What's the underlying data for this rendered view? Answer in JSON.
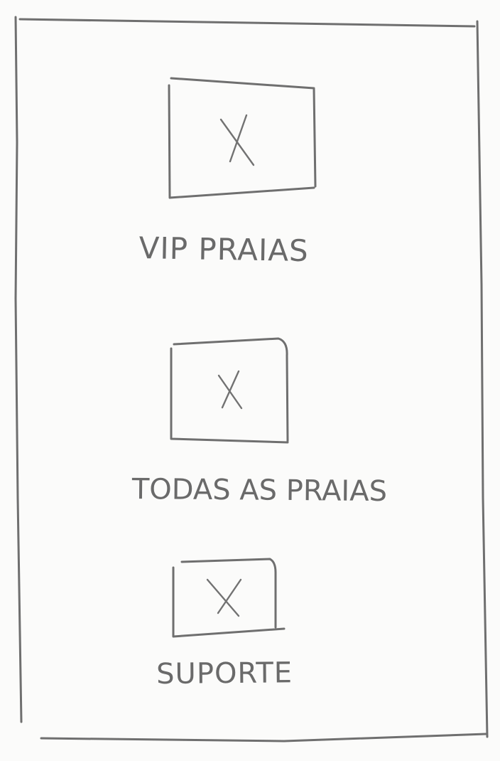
{
  "menu": {
    "items": [
      {
        "label": "VIP PRAIAS",
        "icon": "image-placeholder-icon"
      },
      {
        "label": "TODAS AS PRAIAS",
        "icon": "image-placeholder-icon"
      },
      {
        "label": "SUPORTE",
        "icon": "image-placeholder-icon"
      }
    ]
  },
  "colors": {
    "paper": "#fbfbfa",
    "pencil": "#6f6f6f"
  }
}
